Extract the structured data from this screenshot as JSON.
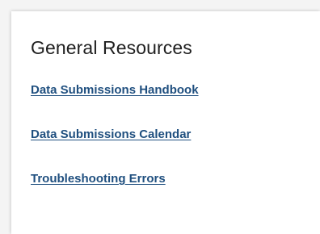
{
  "resources_panel": {
    "title": "General Resources",
    "links": [
      {
        "label": "Data Submissions Handbook"
      },
      {
        "label": "Data Submissions Calendar"
      },
      {
        "label": "Troubleshooting Errors"
      }
    ]
  },
  "colors": {
    "page_background": "#f4f4f4",
    "panel_background": "#ffffff",
    "heading_text": "#1f1f1f",
    "link_text": "#1f4f7f"
  }
}
